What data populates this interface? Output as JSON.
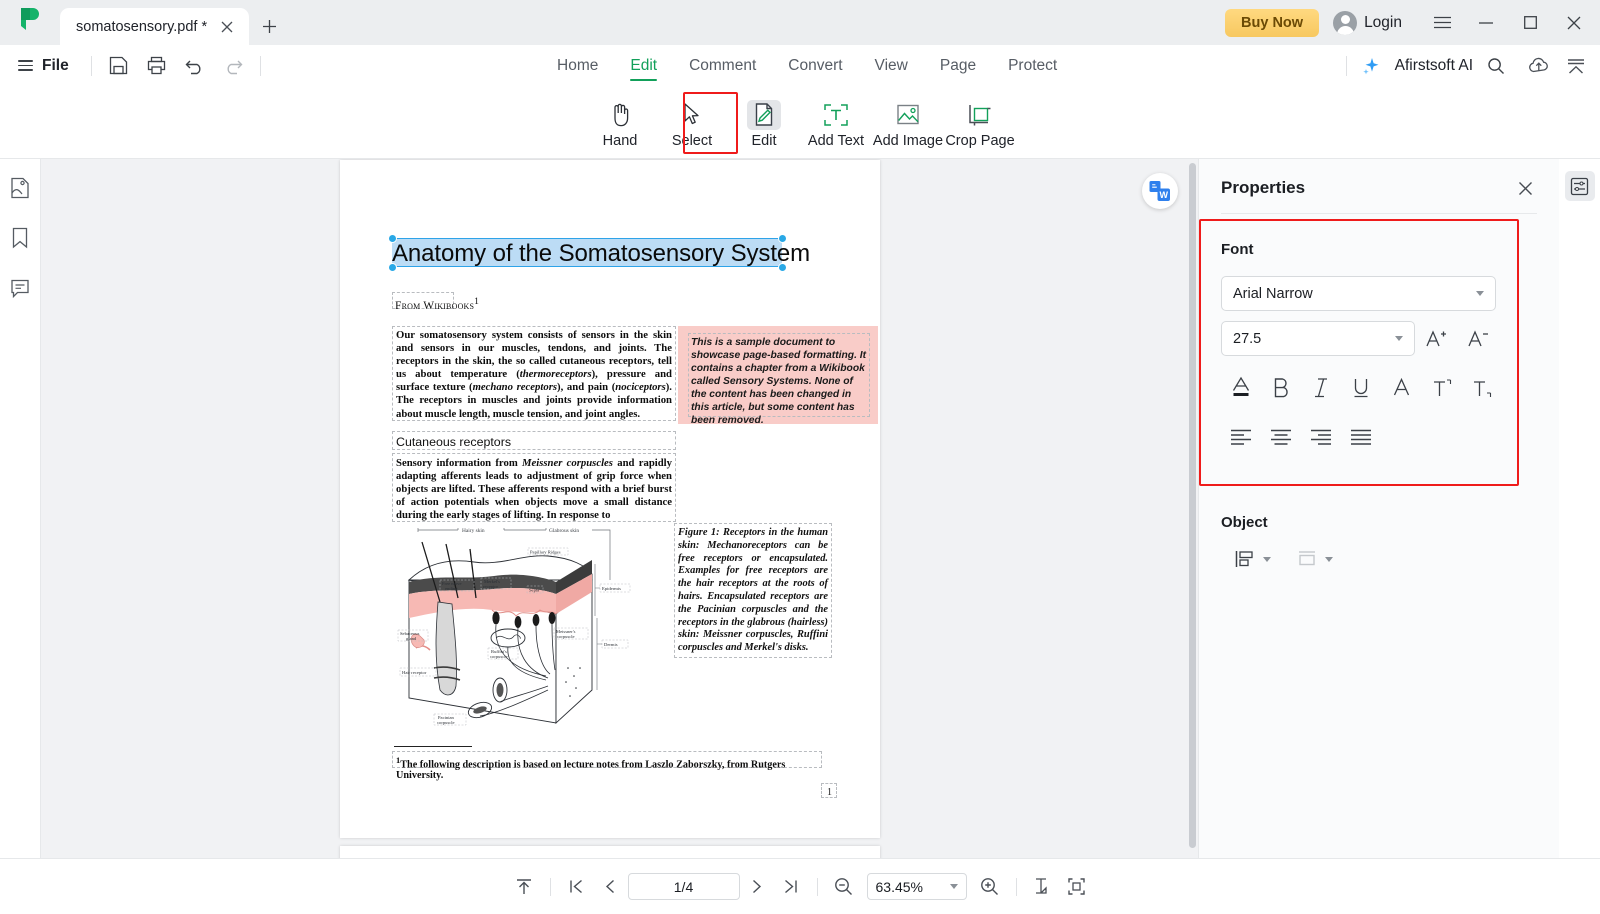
{
  "titlebar": {
    "logo_icon": "afirstsoft-logo-icon",
    "tab": {
      "title": "somatosensory.pdf *",
      "close_icon": "close-icon"
    },
    "new_tab_icon": "plus-icon",
    "buy_now": "Buy Now",
    "login": "Login",
    "menu_icon": "hamburger-menu-icon",
    "minimize_icon": "minimize-icon",
    "maximize_icon": "maximize-icon",
    "close_icon": "window-close-icon"
  },
  "menubar": {
    "file": "File",
    "quick_actions": [
      "save-icon",
      "print-icon",
      "undo-icon",
      "redo-icon"
    ],
    "tabs": [
      {
        "label": "Home",
        "active": false
      },
      {
        "label": "Edit",
        "active": true
      },
      {
        "label": "Comment",
        "active": false
      },
      {
        "label": "Convert",
        "active": false
      },
      {
        "label": "View",
        "active": false
      },
      {
        "label": "Page",
        "active": false
      },
      {
        "label": "Protect",
        "active": false
      }
    ],
    "ai_label": "Afirstsoft AI",
    "search_icon": "search-icon",
    "cloud_icon": "cloud-upload-icon",
    "collapse_icon": "collapse-ribbon-icon"
  },
  "ribbon": {
    "tools": [
      {
        "label": "Hand",
        "icon": "hand-icon",
        "selected": false
      },
      {
        "label": "Select",
        "icon": "cursor-icon",
        "selected": false
      },
      {
        "label": "Edit",
        "icon": "edit-pencil-icon",
        "selected": true
      },
      {
        "label": "Add Text",
        "icon": "add-text-icon",
        "selected": false
      },
      {
        "label": "Add Image",
        "icon": "add-image-icon",
        "selected": false
      },
      {
        "label": "Crop Page",
        "icon": "crop-page-icon",
        "selected": false
      }
    ]
  },
  "left_rail": {
    "items": [
      {
        "icon": "thumbnail-page-icon"
      },
      {
        "icon": "bookmark-icon"
      },
      {
        "icon": "comment-icon"
      }
    ]
  },
  "document": {
    "convert_badge_icon": "convert-to-word-icon",
    "title": "Anatomy of the Somatosensory System",
    "source": "From Wikibooks",
    "source_footnote_marker": "1",
    "paragraph1": "Our somatosensory system consists of sensors in the skin and sensors in our muscles, tendons, and joints. The receptors in the skin, the so called cutaneous receptors, tell us about temperature (thermoreceptors), pressure and surface texture (mechano receptors), and pain (nociceptors). The receptors in muscles and joints provide information about muscle length, muscle tension, and joint angles.",
    "callout": "This is a sample document to showcase page-based formatting. It contains a chapter from a Wikibook called Sensory Systems. None of the content has been changed in this article, but some content has been removed.",
    "section_heading": "Cutaneous receptors",
    "paragraph2": "Sensory information from Meissner corpuscles and rapidly adapting afferents leads to adjustment of grip force when objects are lifted. These afferents respond with a brief burst of action potentials when objects move a small distance during the early stages of lifting. In response to",
    "figure_caption": "Figure 1: Receptors in the human skin: Mechanoreceptors can be free receptors or encapsulated. Examples for free receptors are the hair receptors at the roots of hairs. Encapsulated receptors are the Pacinian corpuscles and the receptors in the glabrous (hairless) skin: Meissner corpuscles, Ruffini corpuscles and Merkel's disks.",
    "footnote": "The following description is based on lecture notes from Laszlo Zaborszky, from Rutgers University.",
    "footnote_marker": "1",
    "page_number_mark": "1",
    "figure_labels": {
      "hairy_skin": "Hairy skin",
      "glabrous_skin": "Glabrous skin",
      "papillary_ridges": "Papillary Ridges",
      "septa": "Septa",
      "epidermis": "Epidermis",
      "dermis": "Dermis",
      "free_nerve": "Free nerve ending",
      "merkel": "Merkel's receptor",
      "meissner": "Meissner's corpuscle",
      "ruffini": "Ruffini's corpuscle",
      "sebaceous": "Sebaceous gland",
      "hair_receptor": "Hair receptor",
      "pacinian": "Pacinian corpuscle"
    }
  },
  "properties_panel": {
    "title": "Properties",
    "close_icon": "close-icon",
    "font_section": {
      "label": "Font",
      "font_family": "Arial Narrow",
      "font_size": "27.5",
      "increase_icon": "increase-font-size-icon",
      "decrease_icon": "decrease-font-size-icon",
      "format_buttons": [
        "font-color-icon",
        "bold-icon",
        "italic-icon",
        "underline-icon",
        "strikethrough-icon",
        "superscript-icon",
        "subscript-icon"
      ],
      "align_buttons": [
        "align-left-icon",
        "align-center-icon",
        "align-right-icon",
        "align-justify-icon"
      ]
    },
    "object_section": {
      "label": "Object",
      "buttons": [
        "align-objects-icon",
        "arrange-objects-icon"
      ]
    },
    "rail_icon": "properties-panel-toggle-icon"
  },
  "statusbar": {
    "scroll_top_icon": "scroll-to-top-icon",
    "first_page_icon": "first-page-icon",
    "prev_page_icon": "previous-page-icon",
    "page_indicator": "1/4",
    "next_page_icon": "next-page-icon",
    "last_page_icon": "last-page-icon",
    "zoom_out_icon": "zoom-out-icon",
    "zoom_level": "63.45%",
    "zoom_in_icon": "zoom-in-icon",
    "fit_page_icon": "fit-page-icon",
    "fit_width_icon": "fit-width-icon"
  },
  "colors": {
    "accent_green": "#12a05a",
    "highlight_red": "#ef1b1b",
    "buy_now_gold": "#f7c860",
    "selection_blue": "#29a8e6",
    "callout_pink": "#f9ccc8"
  }
}
